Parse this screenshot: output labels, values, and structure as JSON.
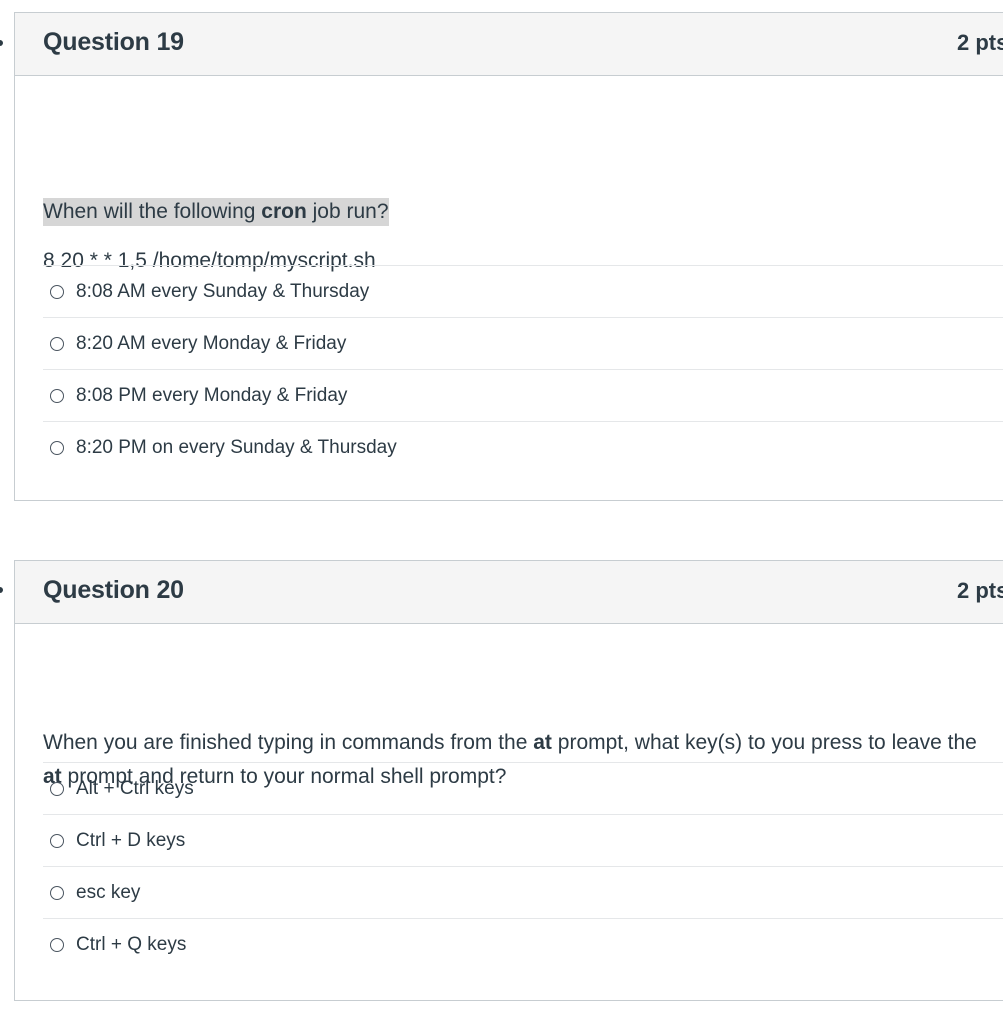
{
  "questions": [
    {
      "title": "Question 19",
      "points": "2 pts",
      "prompt": {
        "before": "When will the following ",
        "bold": "cron",
        "after": " job run?"
      },
      "command": "8 20 * * 1,5  /home/tomp/myscript.sh",
      "answers": [
        "8:08 AM every Sunday & Thursday",
        "8:20 AM every Monday & Friday",
        "8:08 PM every Monday & Friday",
        "8:20 PM on every Sunday & Thursday"
      ]
    },
    {
      "title": "Question 20",
      "points": "2 pts",
      "prompt": {
        "line1_before": "When you are finished typing in commands from the ",
        "line1_bold": "at",
        "line1_after": " prompt, what key(s) to you press to leave the",
        "line2_bold": "at",
        "line2_after": " prompt and return to your normal shell prompt?"
      },
      "answers": [
        "Alt + Ctrl keys",
        "Ctrl + D keys",
        "esc key",
        "Ctrl + Q keys"
      ]
    }
  ]
}
